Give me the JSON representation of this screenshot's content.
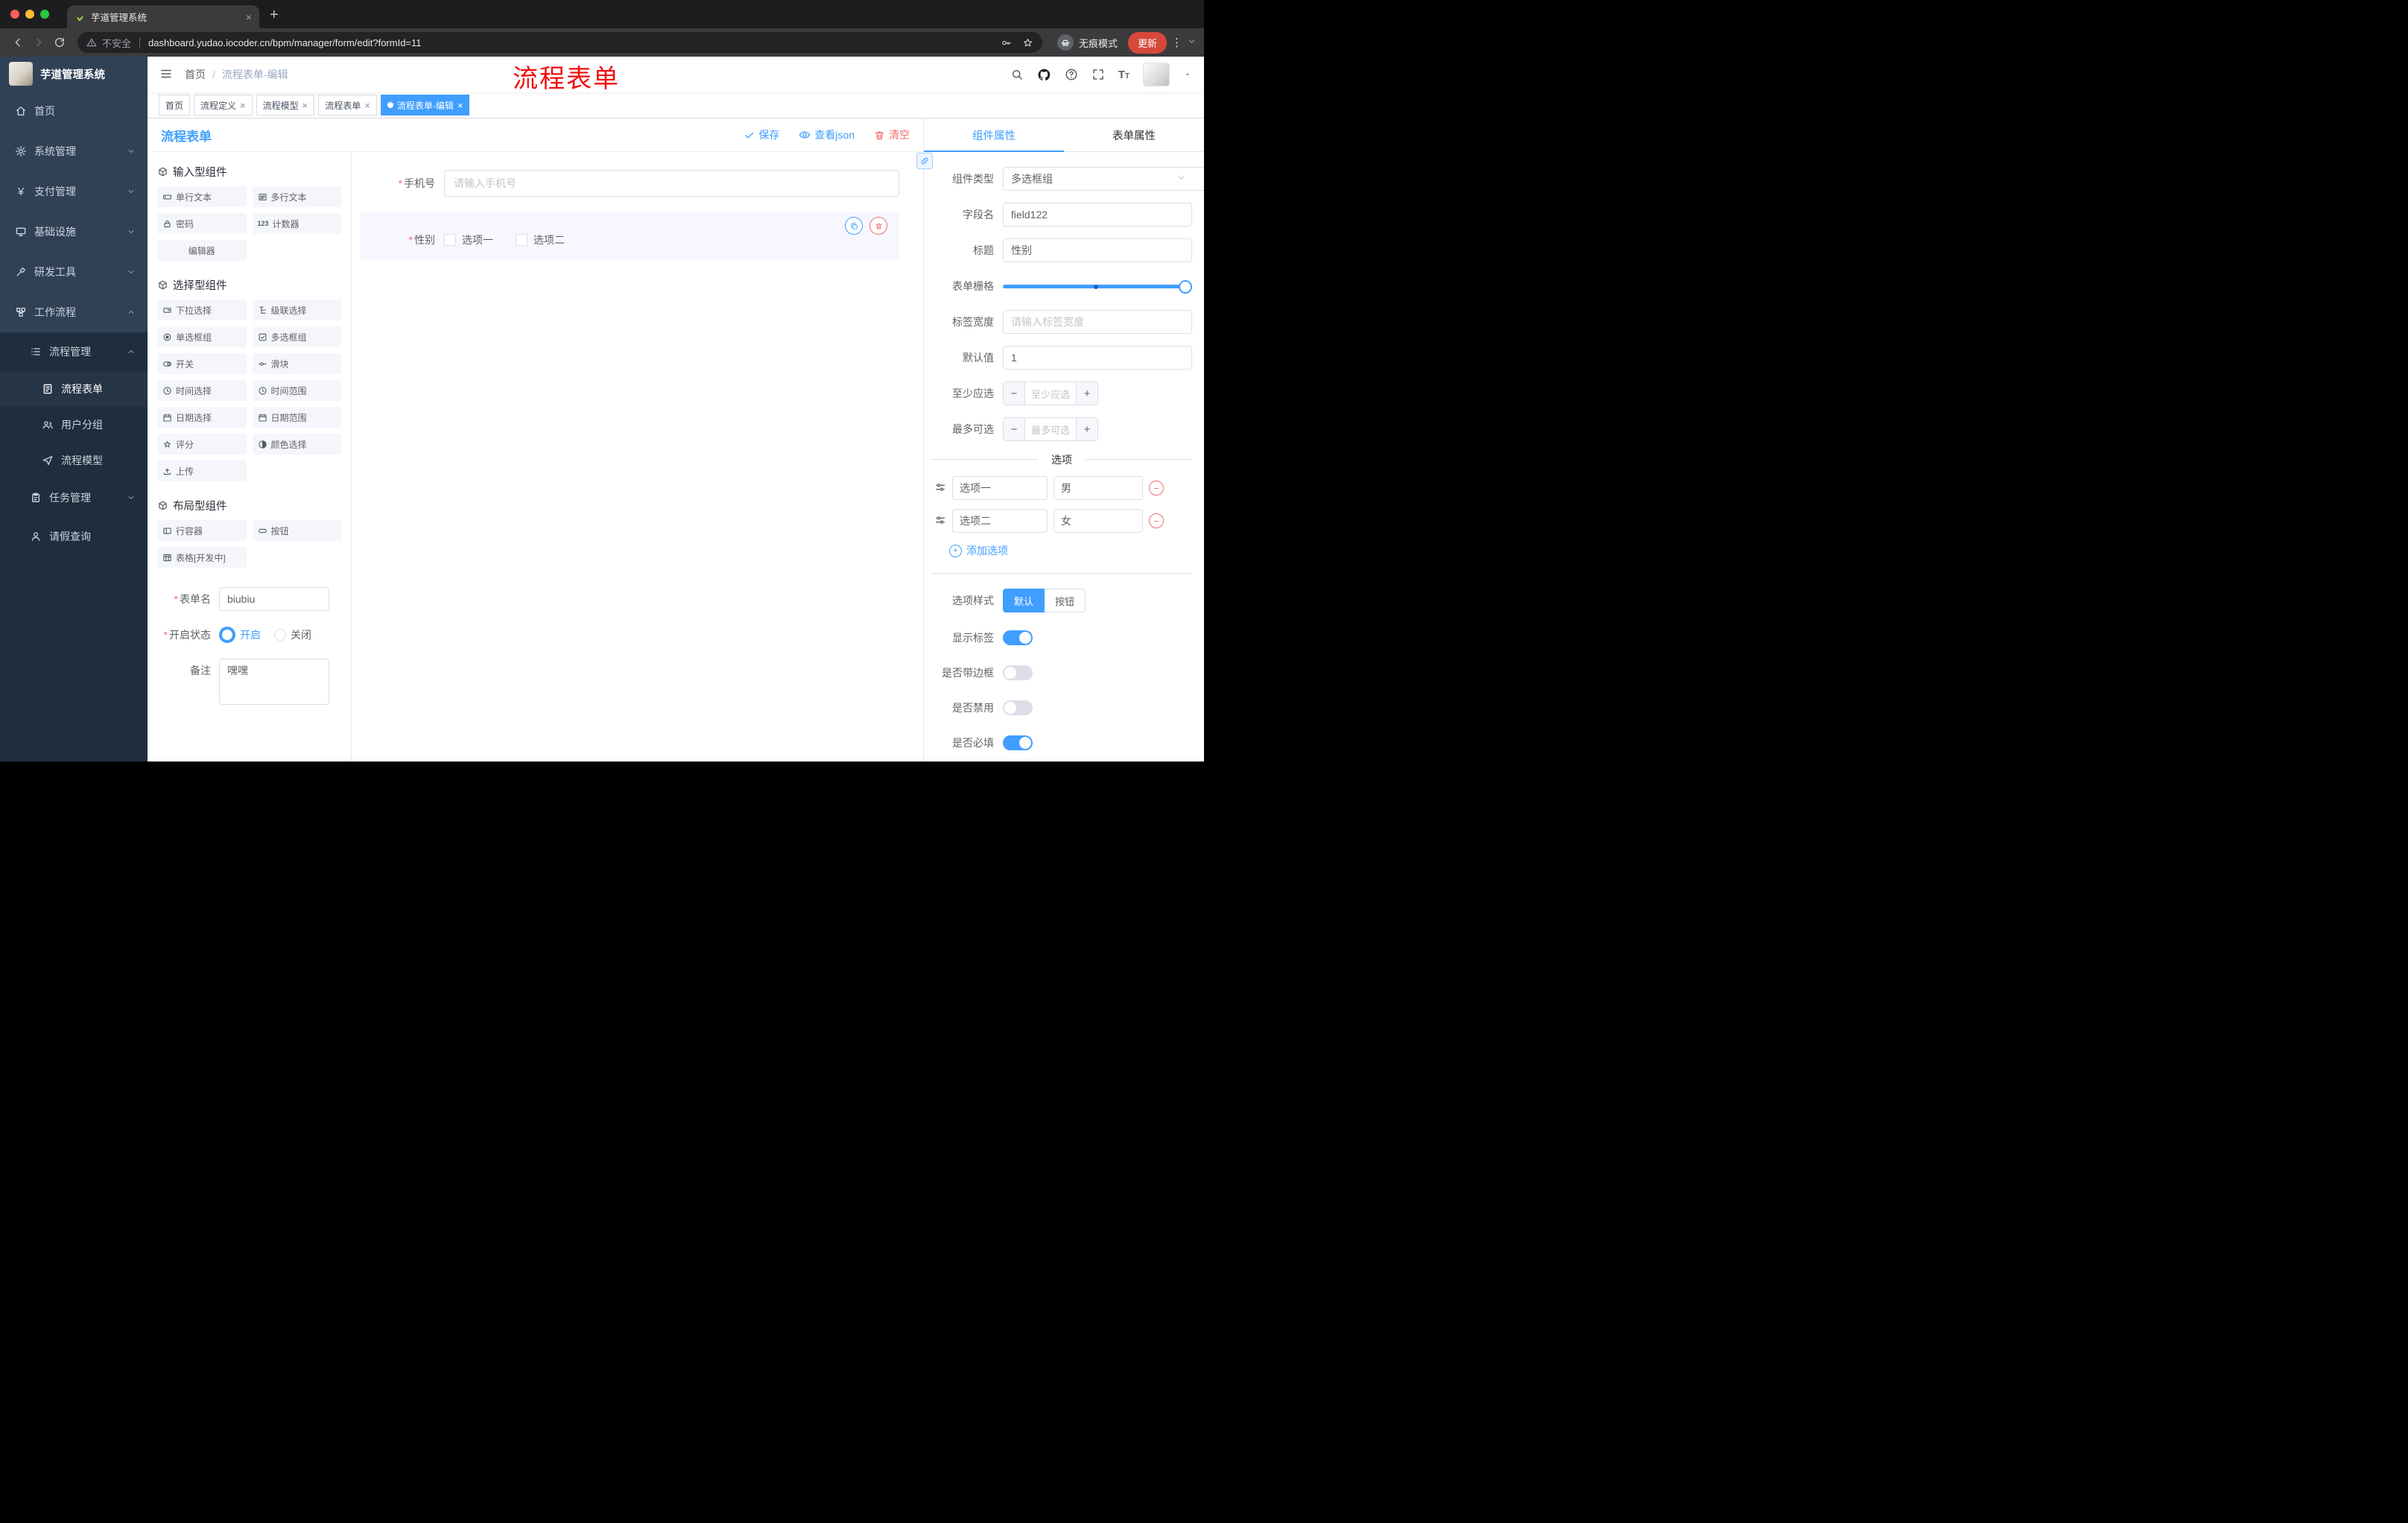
{
  "browser": {
    "tab_title": "芋道管理系统",
    "security_label": "不安全",
    "url": "dashboard.yudao.iocoder.cn/bpm/manager/form/edit?formId=11",
    "incognito_label": "无痕模式",
    "update_label": "更新"
  },
  "annotation": {
    "text": "流程表单",
    "color": "#f20d0d"
  },
  "sidebar": {
    "logo_title": "芋道管理系统",
    "menu": [
      {
        "label": "首页"
      },
      {
        "label": "系统管理"
      },
      {
        "label": "支付管理"
      },
      {
        "label": "基础设施"
      },
      {
        "label": "研发工具"
      },
      {
        "label": "工作流程"
      },
      {
        "label": "流程管理"
      },
      {
        "label": "流程表单"
      },
      {
        "label": "用户分组"
      },
      {
        "label": "流程模型"
      },
      {
        "label": "任务管理"
      },
      {
        "label": "请假查询"
      }
    ]
  },
  "navbar": {
    "breadcrumb_home": "首页",
    "breadcrumb_current": "流程表单-编辑"
  },
  "tags": [
    {
      "label": "首页"
    },
    {
      "label": "流程定义"
    },
    {
      "label": "流程模型"
    },
    {
      "label": "流程表单"
    },
    {
      "label": "流程表单-编辑"
    }
  ],
  "actionbar": {
    "title": "流程表单",
    "save": "保存",
    "view_json": "查看json",
    "clear": "清空"
  },
  "palette": {
    "sections": [
      {
        "title": "输入型组件",
        "items": [
          {
            "label": "单行文本",
            "icon": "text-field-icon"
          },
          {
            "label": "多行文本",
            "icon": "textarea-icon"
          },
          {
            "label": "密码",
            "icon": "lock-icon"
          },
          {
            "label": "计数器",
            "icon": "counter-icon"
          },
          {
            "label": "编辑器",
            "icon": "none"
          }
        ]
      },
      {
        "title": "选择型组件",
        "items": [
          {
            "label": "下拉选择",
            "icon": "select-icon"
          },
          {
            "label": "级联选择",
            "icon": "cascade-icon"
          },
          {
            "label": "单选框组",
            "icon": "radio-icon"
          },
          {
            "label": "多选框组",
            "icon": "checkbox-icon"
          },
          {
            "label": "开关",
            "icon": "switch-icon"
          },
          {
            "label": "滑块",
            "icon": "slider-icon"
          },
          {
            "label": "时间选择",
            "icon": "time-icon"
          },
          {
            "label": "时间范围",
            "icon": "time-range-icon"
          },
          {
            "label": "日期选择",
            "icon": "date-icon"
          },
          {
            "label": "日期范围",
            "icon": "date-range-icon"
          },
          {
            "label": "评分",
            "icon": "star-icon"
          },
          {
            "label": "颜色选择",
            "icon": "color-icon"
          },
          {
            "label": "上传",
            "icon": "upload-icon"
          }
        ]
      },
      {
        "title": "布局型组件",
        "items": [
          {
            "label": "行容器",
            "icon": "row-icon"
          },
          {
            "label": "按钮",
            "icon": "button-icon"
          },
          {
            "label": "表格[开发中]",
            "icon": "table-icon"
          }
        ]
      }
    ],
    "form": {
      "name_label": "表单名",
      "name_value": "biubiu",
      "status_label": "开启状态",
      "status_on": "开启",
      "status_off": "关闭",
      "remark_label": "备注",
      "remark_value": "嘿嘿"
    }
  },
  "canvas": {
    "phone": {
      "label": "手机号",
      "placeholder": "请输入手机号"
    },
    "gender": {
      "label": "性别",
      "option1": "选项一",
      "option2": "选项二"
    }
  },
  "props": {
    "tab_component": "组件属性",
    "tab_form": "表单属性",
    "type_label": "组件类型",
    "type_value": "多选框组",
    "field_label": "字段名",
    "field_value": "field122",
    "title_label": "标题",
    "title_value": "性别",
    "grid_label": "表单栅格",
    "width_label": "标签宽度",
    "width_placeholder": "请输入标签宽度",
    "default_label": "默认值",
    "default_value": "1",
    "min_label": "至少应选",
    "min_placeholder": "至少应选",
    "max_label": "最多可选",
    "max_placeholder": "最多可选",
    "options_title": "选项",
    "options": [
      {
        "name": "选项一",
        "value": "男"
      },
      {
        "name": "选项二",
        "value": "女"
      }
    ],
    "add_option": "添加选项",
    "style_label": "选项样式",
    "style_default": "默认",
    "style_button": "按钮",
    "show_label": "显示标签",
    "border_label": "是否带边框",
    "disabled_label": "是否禁用",
    "required_label": "是否必填"
  },
  "colors": {
    "primary": "#409eff",
    "danger": "#f56c6c",
    "sidebar": "#304156"
  }
}
